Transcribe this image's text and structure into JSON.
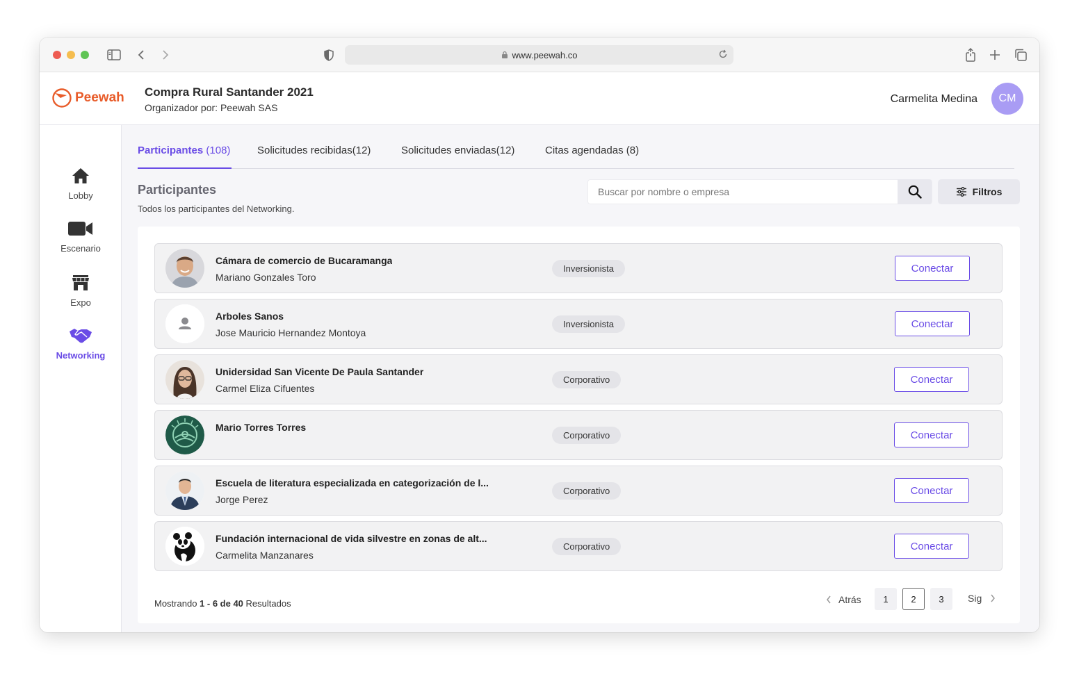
{
  "browser": {
    "url": "www.peewah.co"
  },
  "header": {
    "logo_text": "Peewah",
    "event_title": "Compra Rural Santander 2021",
    "organizer": "Organizador por: Peewah SAS",
    "user_name": "Carmelita Medina",
    "user_initials": "CM"
  },
  "sidebar": {
    "items": [
      {
        "label": "Lobby",
        "icon": "home-icon"
      },
      {
        "label": "Escenario",
        "icon": "video-camera-icon"
      },
      {
        "label": "Expo",
        "icon": "storefront-icon"
      },
      {
        "label": "Networking",
        "icon": "handshake-icon",
        "active": true
      }
    ]
  },
  "tabs": [
    {
      "label": "Participantes",
      "count": " (108)",
      "active": true
    },
    {
      "label": "Solicitudes recibidas(12)"
    },
    {
      "label": "Solicitudes enviadas(12)"
    },
    {
      "label": "Citas agendadas (8)"
    }
  ],
  "section": {
    "title": "Participantes",
    "subtitle": "Todos los participantes del Networking.",
    "search_placeholder": "Buscar por nombre o empresa",
    "filter_label": "Filtros"
  },
  "participants": [
    {
      "org": "Cámara de comercio de Bucaramanga",
      "person": "Mariano Gonzales Toro",
      "type": "Inversionista",
      "avatar": "man-photo",
      "action": "Conectar"
    },
    {
      "org": "Arboles Sanos",
      "person": "Jose Mauricio Hernandez Montoya",
      "type": "Inversionista",
      "avatar": "default-user",
      "action": "Conectar"
    },
    {
      "org": "Unidersidad San Vicente De Paula Santander",
      "person": "Carmel Eliza Cifuentes",
      "type": "Corporativo",
      "avatar": "woman-photo",
      "action": "Conectar"
    },
    {
      "org": "Mario Torres Torres",
      "person": "",
      "type": "Corporativo",
      "avatar": "green-logo",
      "action": "Conectar"
    },
    {
      "org": "Escuela de literatura especializada en categorización de l...",
      "person": "Jorge Perez",
      "type": "Corporativo",
      "avatar": "man-suit-photo",
      "action": "Conectar"
    },
    {
      "org": "Fundación internacional de vida silvestre en zonas de alt...",
      "person": "Carmelita Manzanares",
      "type": "Corporativo",
      "avatar": "panda-logo",
      "action": "Conectar"
    }
  ],
  "footer": {
    "showing_prefix": "Mostrando ",
    "showing_range": "1 - 6 de 40",
    "showing_suffix": " Resultados"
  },
  "pagination": {
    "prev": "Atrás",
    "next": "Sig",
    "pages": [
      "1",
      "2",
      "3"
    ],
    "current": "2"
  },
  "colors": {
    "accent": "#6a4ce6",
    "brand_orange": "#e85c2a",
    "avatar_bg": "#a99cf4"
  }
}
